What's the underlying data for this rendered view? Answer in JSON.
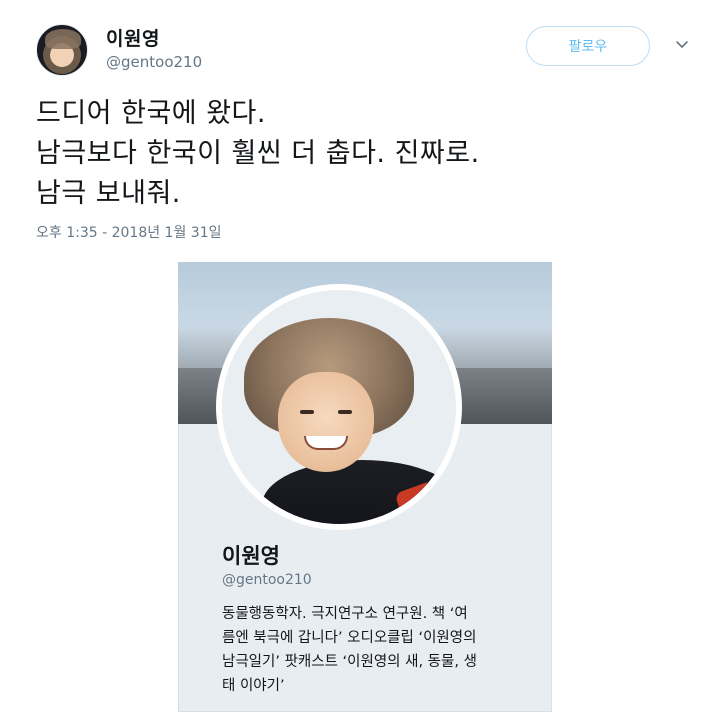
{
  "tweet": {
    "author": {
      "name": "이원영",
      "handle": "@gentoo210"
    },
    "follow_label": "팔로우",
    "text_lines": [
      "드디어 한국에 왔다.",
      "남극보다 한국이 훨씬 더 춥다. 진짜로.",
      "남극 보내줘."
    ],
    "timestamp": "오후 1:35 - 2018년 1월 31일"
  },
  "profile_card": {
    "name": "이원영",
    "handle": "@gentoo210",
    "bio_lines": [
      "동물행동학자. 극지연구소 연구원. 책 ‘여",
      "름엔 북극에 갑니다’ 오디오클립 ‘이원영의",
      "남극일기’ 팟캐스트 ‘이원영의 새, 동물, 생",
      "태 이야기’"
    ]
  },
  "icons": {
    "more": "chevron-down-icon"
  },
  "colors": {
    "accent": "#1da1f2",
    "muted": "#657786",
    "card_bg": "#e8edf2"
  }
}
